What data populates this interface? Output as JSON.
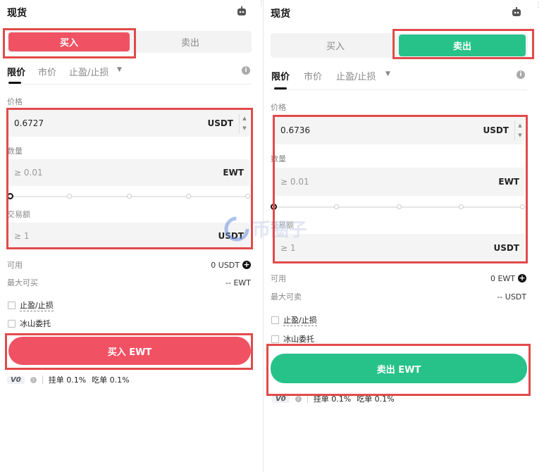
{
  "left": {
    "title": "现货",
    "buy_label": "买入",
    "sell_label": "卖出",
    "tabs": [
      "限价",
      "市价",
      "止盈/止损"
    ],
    "price_label": "价格",
    "price_value": "0.6727",
    "price_unit": "USDT",
    "qty_label": "数量",
    "qty_placeholder": "≥ 0.01",
    "qty_unit": "EWT",
    "amount_label": "交易额",
    "amount_placeholder": "≥ 1",
    "amount_unit": "USDT",
    "available_label": "可用",
    "available_value": "0 USDT",
    "max_label": "最大可买",
    "max_value": "-- EWT",
    "tpsl_label": "止盈/止损",
    "iceberg_label": "冰山委托",
    "action_label": "买入 EWT",
    "vip": "V0",
    "maker": "挂单 0.1%",
    "taker": "吃单 0.1%"
  },
  "right": {
    "title": "现货",
    "buy_label": "买入",
    "sell_label": "卖出",
    "tabs": [
      "限价",
      "市价",
      "止盈/止损"
    ],
    "price_label": "价格",
    "price_value": "0.6736",
    "price_unit": "USDT",
    "qty_label": "数量",
    "qty_placeholder": "≥ 0.01",
    "qty_unit": "EWT",
    "amount_label": "交易额",
    "amount_placeholder": "≥ 1",
    "amount_unit": "USDT",
    "available_label": "可用",
    "available_value": "0 EWT",
    "max_label": "最大可卖",
    "max_value": "-- USDT",
    "tpsl_label": "止盈/止损",
    "iceberg_label": "冰山委托",
    "action_label": "卖出 EWT",
    "vip": "V0",
    "maker": "挂单 0.1%",
    "taker": "吃单 0.1%"
  },
  "watermark": "币圈子",
  "colors": {
    "buy": "#f05264",
    "sell": "#27c28a",
    "highlight": "#e24a4a"
  },
  "icons": [
    "robot-icon",
    "info-icon",
    "plus-circle-icon",
    "caret-down-icon"
  ]
}
